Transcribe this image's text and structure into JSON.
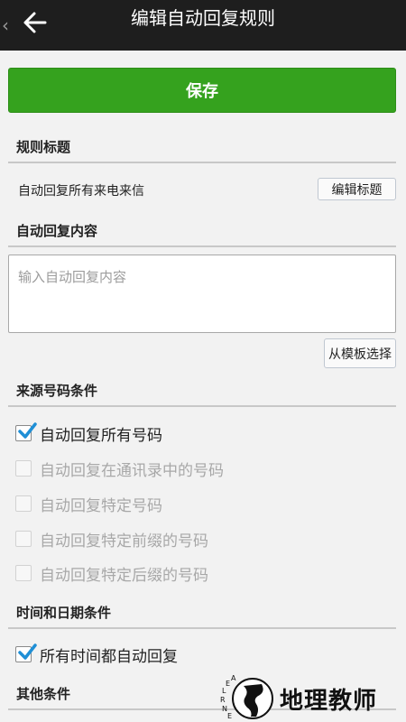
{
  "header": {
    "title": "编辑自动回复规则",
    "back_chevron": "‹"
  },
  "save_button": {
    "label": "保存"
  },
  "rule_title": {
    "section": "规则标题",
    "value": "自动回复所有来电来信",
    "edit_button": "编辑标题"
  },
  "reply_content": {
    "section": "自动回复内容",
    "placeholder": "输入自动回复内容",
    "template_button": "从模板选择"
  },
  "source_conditions": {
    "section": "来源号码条件",
    "options": [
      {
        "label": "自动回复所有号码",
        "checked": true,
        "enabled": true
      },
      {
        "label": "自动回复在通讯录中的号码",
        "checked": false,
        "enabled": false
      },
      {
        "label": "自动回复特定号码",
        "checked": false,
        "enabled": false
      },
      {
        "label": "自动回复特定前缀的号码",
        "checked": false,
        "enabled": false
      },
      {
        "label": "自动回复特定后缀的号码",
        "checked": false,
        "enabled": false
      }
    ]
  },
  "time_conditions": {
    "section": "时间和日期条件",
    "options": [
      {
        "label": "所有时间都自动回复",
        "checked": true,
        "enabled": true
      }
    ]
  },
  "other_conditions": {
    "section": "其他条件"
  },
  "watermark": {
    "text": "地理教师",
    "logo_letters": "LEARNE"
  },
  "colors": {
    "topbar": "#1e1e1e",
    "save_green": "#35a21e",
    "check_blue": "#1f8fd6",
    "background": "#f2f2f2"
  }
}
